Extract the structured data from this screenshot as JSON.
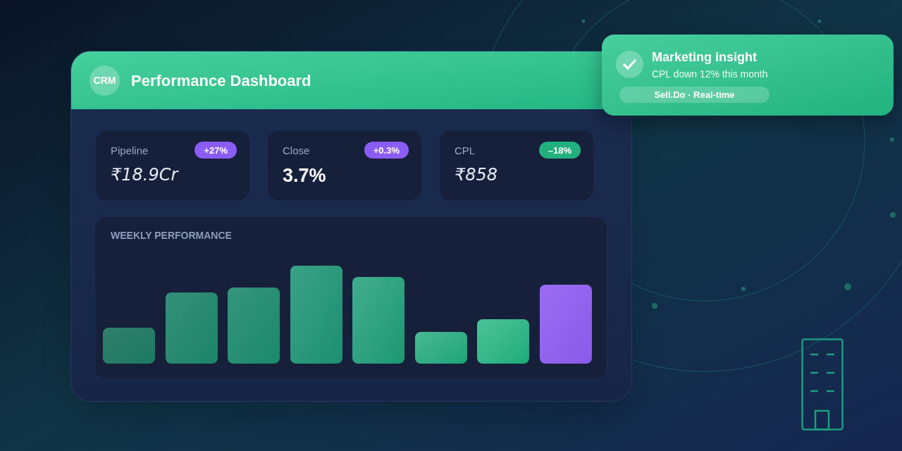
{
  "header": {
    "logo": "CRM",
    "title": "Performance Dashboard"
  },
  "metrics": [
    {
      "label": "Pipeline",
      "value": "₹18.9Cr",
      "kind": "currency",
      "badge": {
        "text": "+27%",
        "color": "#8b5cf6"
      }
    },
    {
      "label": "Close",
      "value": "3.7%",
      "kind": "percent",
      "badge": {
        "text": "+0.3%",
        "color": "#8b5cf6"
      }
    },
    {
      "label": "CPL",
      "value": "₹858",
      "kind": "currency",
      "badge": {
        "text": "–18%",
        "color": "#22b07f"
      }
    }
  ],
  "chart": {
    "title": "WEEKLY PERFORMANCE"
  },
  "toast": {
    "title": "Marketing insight",
    "message": "CPL down 12% this month",
    "tag": "Sell.Do · Real-time"
  }
}
